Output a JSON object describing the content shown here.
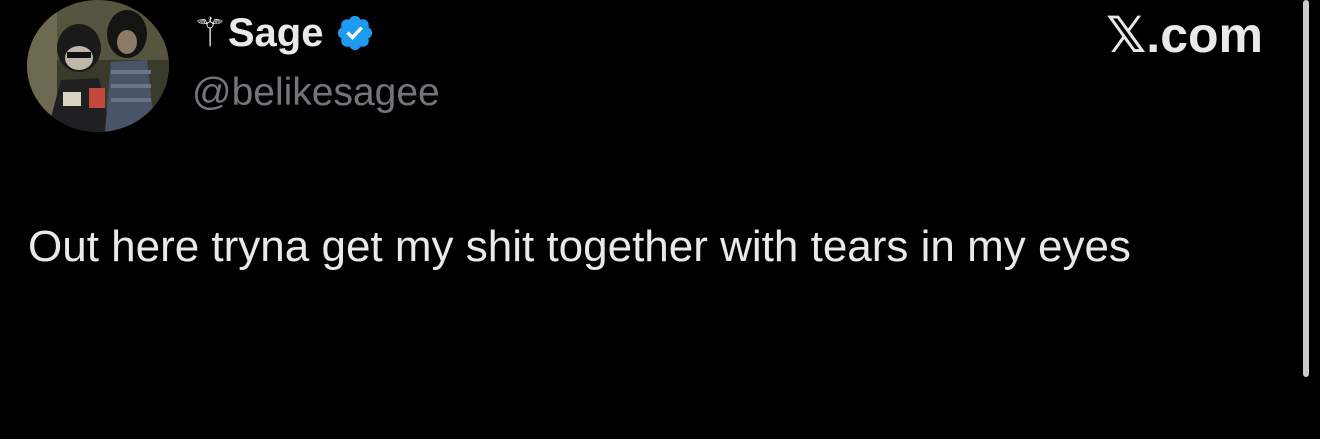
{
  "tweet": {
    "display_name": "⚚Sage",
    "handle": "@belikesagee",
    "text": "Out here tryna get my shit together with tears in my eyes",
    "verified": true
  },
  "watermark": "𝕏.com",
  "icons": {
    "verified": "verified-badge-icon",
    "avatar": "profile-avatar"
  },
  "colors": {
    "background": "#000000",
    "text": "#e7e9ea",
    "secondary_text": "#71767b",
    "verified_blue": "#1d9bf0"
  }
}
